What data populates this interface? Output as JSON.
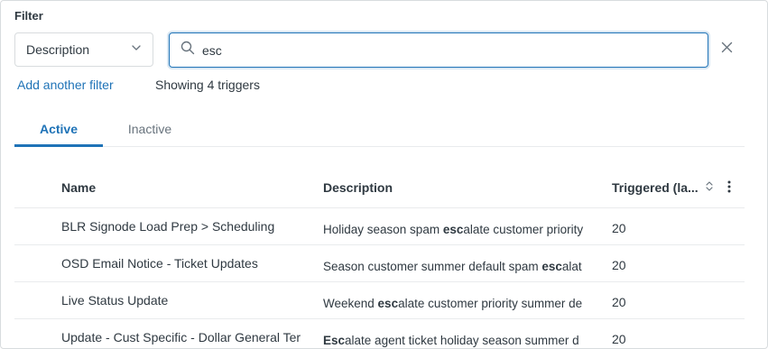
{
  "filter": {
    "label": "Filter",
    "field_select": {
      "value": "Description"
    },
    "search": {
      "value": "esc",
      "placeholder": ""
    },
    "add_filter_label": "Add another filter",
    "result_text": "Showing 4 triggers"
  },
  "tabs": [
    {
      "label": "Active",
      "selected": true
    },
    {
      "label": "Inactive",
      "selected": false
    }
  ],
  "table": {
    "columns": {
      "name": "Name",
      "description": "Description",
      "triggered": "Triggered (la..."
    },
    "rows": [
      {
        "name": "BLR Signode Load Prep > Scheduling",
        "description": {
          "before": "Holiday season spam ",
          "match": "esc",
          "after": "alate customer priority"
        },
        "triggered": "20"
      },
      {
        "name": "OSD Email Notice - Ticket Updates",
        "description": {
          "before": "Season customer summer default spam ",
          "match": "esc",
          "after": "alat"
        },
        "triggered": "20"
      },
      {
        "name": "Live Status Update",
        "description": {
          "before": "Weekend ",
          "match": "esc",
          "after": "alate customer priority summer de"
        },
        "triggered": "20"
      },
      {
        "name": "Update - Cust Specific - Dollar General Ter",
        "description": {
          "before": "",
          "match": "Esc",
          "after": "alate agent ticket holiday season  summer d"
        },
        "triggered": "20"
      }
    ]
  },
  "colors": {
    "accent": "#1f73b7",
    "text": "#2f3941",
    "muted": "#68737d",
    "border": "#d8dcde"
  },
  "icons": [
    "chevron-down-icon",
    "search-icon",
    "close-icon",
    "sort-icon",
    "kebab-menu-icon"
  ]
}
